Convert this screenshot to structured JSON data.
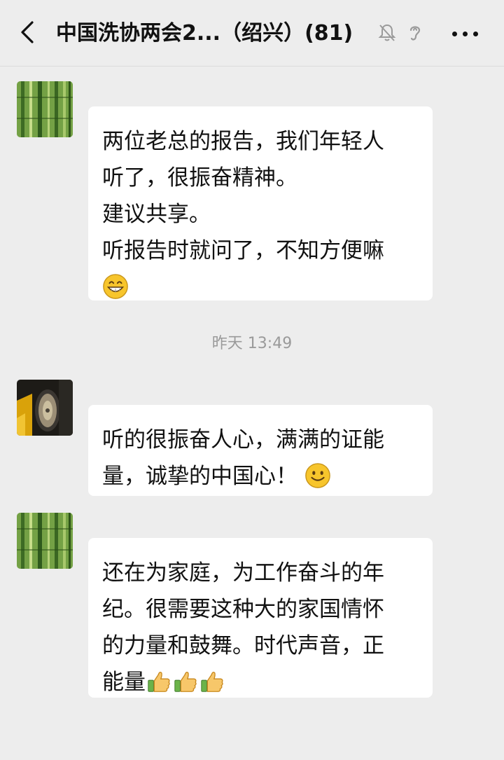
{
  "header": {
    "title": "中国洗协两会2...（绍兴）(81)"
  },
  "messages": [
    {
      "lines": [
        "两位老总的报告，我们年轻人",
        "听了，很振奋精神。",
        "建议共享。",
        "听报告时就问了，不知方便嘛"
      ],
      "emojis": [
        "grin-emoji"
      ]
    },
    {
      "lines": [
        "听的很振奋人心，满满的证能",
        "量，诚挚的中国心！"
      ],
      "emojis": [
        "smile-emoji"
      ]
    },
    {
      "lines": [
        "还在为家庭，为工作奋斗的年",
        "纪。很需要这种大的家国情怀",
        "的力量和鼓舞。时代声音，正",
        "能量"
      ],
      "emojis": [
        "thumbs-up-emoji",
        "thumbs-up-emoji",
        "thumbs-up-emoji"
      ]
    }
  ],
  "timestamp": "昨天 13:49"
}
